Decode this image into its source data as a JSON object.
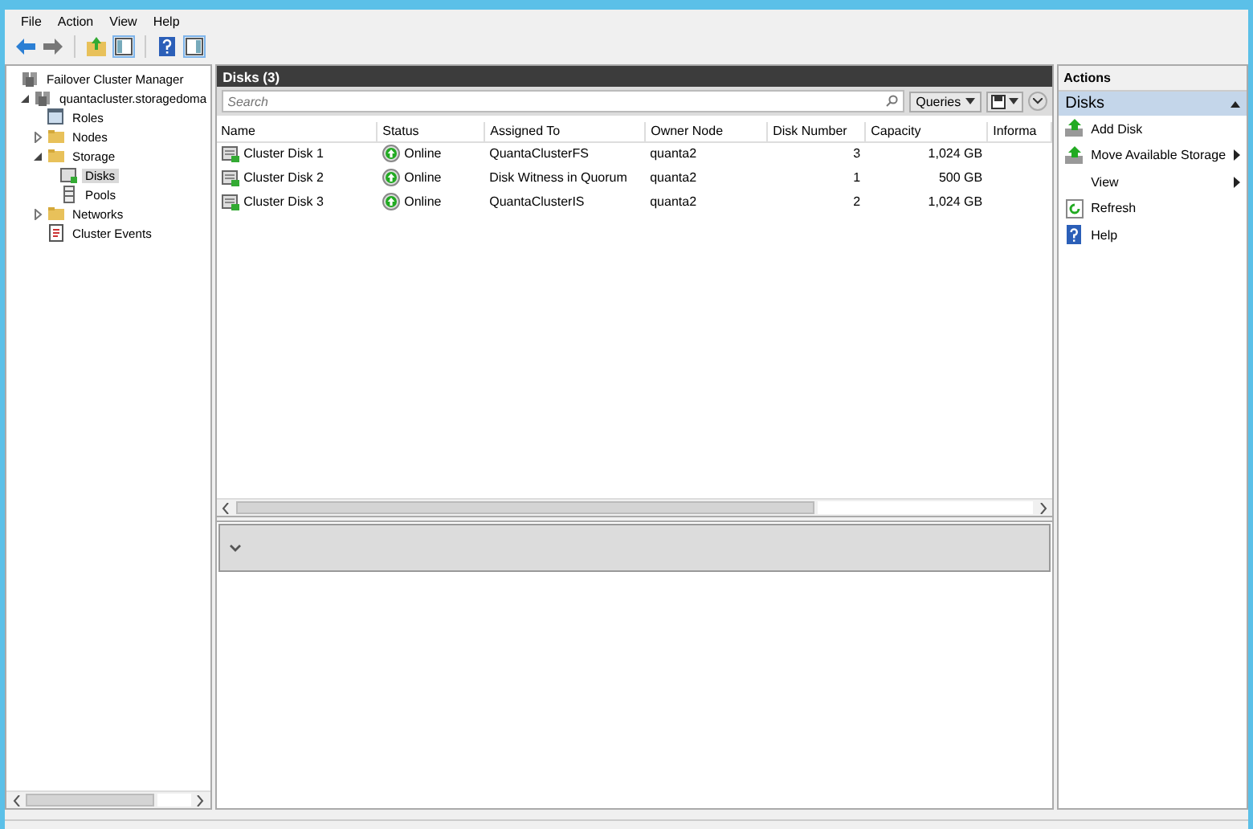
{
  "menu": [
    "File",
    "Action",
    "View",
    "Help"
  ],
  "tree": [
    {
      "label": "Failover Cluster Manager",
      "kind": "manager",
      "selected": false,
      "children": [
        {
          "label": "quantacluster.storagedoma",
          "kind": "cluster",
          "expanded": true,
          "selected": false,
          "children": [
            {
              "label": "Roles",
              "kind": "roles",
              "selected": false
            },
            {
              "label": "Nodes",
              "kind": "folder",
              "expanded": false,
              "selected": false
            },
            {
              "label": "Storage",
              "kind": "folder",
              "expanded": true,
              "selected": false,
              "children": [
                {
                  "label": "Disks",
                  "kind": "disk",
                  "selected": true
                },
                {
                  "label": "Pools",
                  "kind": "pool",
                  "selected": false
                }
              ]
            },
            {
              "label": "Networks",
              "kind": "folder",
              "expanded": false,
              "selected": false
            },
            {
              "label": "Cluster Events",
              "kind": "events",
              "selected": false
            }
          ]
        }
      ]
    }
  ],
  "center": {
    "title": "Disks (3)",
    "search": {
      "placeholder": "Search"
    },
    "queries": "Queries",
    "table": {
      "columns": [
        "Name",
        "Status",
        "Assigned To",
        "Owner Node",
        "Disk Number",
        "Capacity",
        "Informa"
      ],
      "rows": [
        {
          "name": "Cluster Disk 1",
          "status": "Online",
          "assigned_to": "QuantaClusterFS",
          "owner_node": "quanta2",
          "disk_number": "3",
          "capacity": "1,024 GB"
        },
        {
          "name": "Cluster Disk 2",
          "status": "Online",
          "assigned_to": "Disk Witness in Quorum",
          "owner_node": "quanta2",
          "disk_number": "1",
          "capacity": "500 GB"
        },
        {
          "name": "Cluster Disk 3",
          "status": "Online",
          "assigned_to": "QuantaClusterIS",
          "owner_node": "quanta2",
          "disk_number": "2",
          "capacity": "1,024 GB"
        }
      ]
    }
  },
  "actions": {
    "title": "Actions",
    "group": {
      "label": "Disks",
      "expanded": true
    },
    "items": [
      {
        "label": "Add Disk",
        "kind": "add",
        "submenu": false
      },
      {
        "label": "Move Available Storage",
        "kind": "move",
        "submenu": true
      },
      {
        "label": "View",
        "kind": "plain",
        "submenu": true
      },
      {
        "label": "Refresh",
        "kind": "refresh",
        "submenu": false
      },
      {
        "label": "Help",
        "kind": "help",
        "submenu": false
      }
    ]
  }
}
